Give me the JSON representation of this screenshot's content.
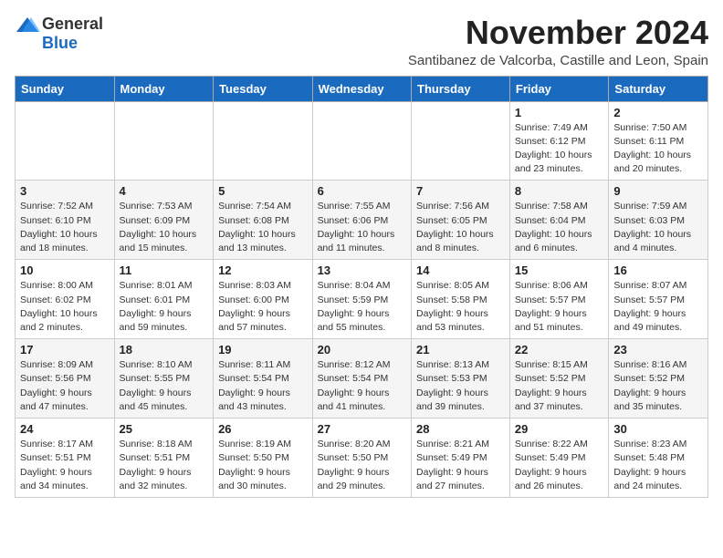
{
  "logo": {
    "general": "General",
    "blue": "Blue"
  },
  "title": "November 2024",
  "subtitle": "Santibanez de Valcorba, Castille and Leon, Spain",
  "headers": [
    "Sunday",
    "Monday",
    "Tuesday",
    "Wednesday",
    "Thursday",
    "Friday",
    "Saturday"
  ],
  "weeks": [
    [
      {
        "day": "",
        "info": ""
      },
      {
        "day": "",
        "info": ""
      },
      {
        "day": "",
        "info": ""
      },
      {
        "day": "",
        "info": ""
      },
      {
        "day": "",
        "info": ""
      },
      {
        "day": "1",
        "info": "Sunrise: 7:49 AM\nSunset: 6:12 PM\nDaylight: 10 hours and 23 minutes."
      },
      {
        "day": "2",
        "info": "Sunrise: 7:50 AM\nSunset: 6:11 PM\nDaylight: 10 hours and 20 minutes."
      }
    ],
    [
      {
        "day": "3",
        "info": "Sunrise: 7:52 AM\nSunset: 6:10 PM\nDaylight: 10 hours and 18 minutes."
      },
      {
        "day": "4",
        "info": "Sunrise: 7:53 AM\nSunset: 6:09 PM\nDaylight: 10 hours and 15 minutes."
      },
      {
        "day": "5",
        "info": "Sunrise: 7:54 AM\nSunset: 6:08 PM\nDaylight: 10 hours and 13 minutes."
      },
      {
        "day": "6",
        "info": "Sunrise: 7:55 AM\nSunset: 6:06 PM\nDaylight: 10 hours and 11 minutes."
      },
      {
        "day": "7",
        "info": "Sunrise: 7:56 AM\nSunset: 6:05 PM\nDaylight: 10 hours and 8 minutes."
      },
      {
        "day": "8",
        "info": "Sunrise: 7:58 AM\nSunset: 6:04 PM\nDaylight: 10 hours and 6 minutes."
      },
      {
        "day": "9",
        "info": "Sunrise: 7:59 AM\nSunset: 6:03 PM\nDaylight: 10 hours and 4 minutes."
      }
    ],
    [
      {
        "day": "10",
        "info": "Sunrise: 8:00 AM\nSunset: 6:02 PM\nDaylight: 10 hours and 2 minutes."
      },
      {
        "day": "11",
        "info": "Sunrise: 8:01 AM\nSunset: 6:01 PM\nDaylight: 9 hours and 59 minutes."
      },
      {
        "day": "12",
        "info": "Sunrise: 8:03 AM\nSunset: 6:00 PM\nDaylight: 9 hours and 57 minutes."
      },
      {
        "day": "13",
        "info": "Sunrise: 8:04 AM\nSunset: 5:59 PM\nDaylight: 9 hours and 55 minutes."
      },
      {
        "day": "14",
        "info": "Sunrise: 8:05 AM\nSunset: 5:58 PM\nDaylight: 9 hours and 53 minutes."
      },
      {
        "day": "15",
        "info": "Sunrise: 8:06 AM\nSunset: 5:57 PM\nDaylight: 9 hours and 51 minutes."
      },
      {
        "day": "16",
        "info": "Sunrise: 8:07 AM\nSunset: 5:57 PM\nDaylight: 9 hours and 49 minutes."
      }
    ],
    [
      {
        "day": "17",
        "info": "Sunrise: 8:09 AM\nSunset: 5:56 PM\nDaylight: 9 hours and 47 minutes."
      },
      {
        "day": "18",
        "info": "Sunrise: 8:10 AM\nSunset: 5:55 PM\nDaylight: 9 hours and 45 minutes."
      },
      {
        "day": "19",
        "info": "Sunrise: 8:11 AM\nSunset: 5:54 PM\nDaylight: 9 hours and 43 minutes."
      },
      {
        "day": "20",
        "info": "Sunrise: 8:12 AM\nSunset: 5:54 PM\nDaylight: 9 hours and 41 minutes."
      },
      {
        "day": "21",
        "info": "Sunrise: 8:13 AM\nSunset: 5:53 PM\nDaylight: 9 hours and 39 minutes."
      },
      {
        "day": "22",
        "info": "Sunrise: 8:15 AM\nSunset: 5:52 PM\nDaylight: 9 hours and 37 minutes."
      },
      {
        "day": "23",
        "info": "Sunrise: 8:16 AM\nSunset: 5:52 PM\nDaylight: 9 hours and 35 minutes."
      }
    ],
    [
      {
        "day": "24",
        "info": "Sunrise: 8:17 AM\nSunset: 5:51 PM\nDaylight: 9 hours and 34 minutes."
      },
      {
        "day": "25",
        "info": "Sunrise: 8:18 AM\nSunset: 5:51 PM\nDaylight: 9 hours and 32 minutes."
      },
      {
        "day": "26",
        "info": "Sunrise: 8:19 AM\nSunset: 5:50 PM\nDaylight: 9 hours and 30 minutes."
      },
      {
        "day": "27",
        "info": "Sunrise: 8:20 AM\nSunset: 5:50 PM\nDaylight: 9 hours and 29 minutes."
      },
      {
        "day": "28",
        "info": "Sunrise: 8:21 AM\nSunset: 5:49 PM\nDaylight: 9 hours and 27 minutes."
      },
      {
        "day": "29",
        "info": "Sunrise: 8:22 AM\nSunset: 5:49 PM\nDaylight: 9 hours and 26 minutes."
      },
      {
        "day": "30",
        "info": "Sunrise: 8:23 AM\nSunset: 5:48 PM\nDaylight: 9 hours and 24 minutes."
      }
    ]
  ]
}
